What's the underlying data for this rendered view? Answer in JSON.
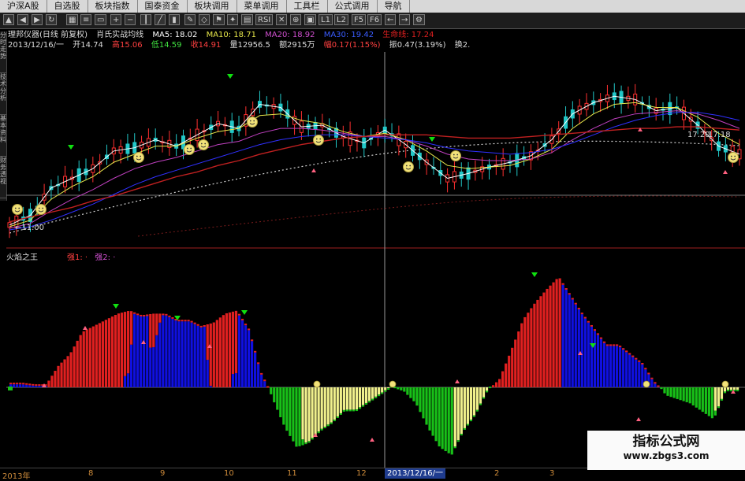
{
  "menu": [
    {
      "label": "沪深A股"
    },
    {
      "label": "自选股"
    },
    {
      "label": "板块指数"
    },
    {
      "label": "国泰资金"
    },
    {
      "label": "板块调用"
    },
    {
      "label": "菜单调用"
    },
    {
      "label": "工具栏"
    },
    {
      "label": "公式调用"
    },
    {
      "label": "导航"
    }
  ],
  "toolbar": [
    {
      "label": "RSI"
    },
    {
      "label": "L1"
    },
    {
      "label": "L2"
    },
    {
      "label": "F5"
    },
    {
      "label": "F6"
    }
  ],
  "side_tabs": [
    {
      "label": "分时走势"
    },
    {
      "label": "技术分析"
    },
    {
      "label": "基本资料"
    },
    {
      "label": "财务透视"
    }
  ],
  "stock": {
    "name": "理邦仪器(日线 前复权)",
    "indicator_name": "肖氏实战均线",
    "ma5": "MA5: 18.02",
    "ma10": "MA10: 18.71",
    "ma20": "MA20: 18.92",
    "ma30": "MA30: 19.42",
    "life_line": "生命线: 17.24",
    "date": "2013/12/16/一",
    "open": "开14.74",
    "high": "高15.06",
    "low": "低14.59",
    "close": "收14.91",
    "volume": "量12956.5",
    "amount": "额2915万",
    "change": "幅0.17(1.15%)",
    "amplitude": "振0.47(3.19%)",
    "turnover": "换2."
  },
  "price_labels": {
    "low": "←11.00",
    "right1": "17.20",
    "right2": "17.18"
  },
  "indicator": {
    "title": "火焰之王",
    "legend1": "强1: ·",
    "legend2": "强2: ·"
  },
  "bottom_axis": {
    "year": "2013年",
    "months": [
      "8",
      "9",
      "10",
      "11",
      "12",
      "2",
      "3"
    ],
    "cursor_date": "2013/12/16/一"
  },
  "watermark": {
    "title": "指标公式网",
    "url": "www.zbgs3.com"
  },
  "colors": {
    "up": "#ff3030",
    "down": "#22c8c8",
    "ma5": "#ffffff",
    "ma10": "#e6e64a",
    "ma20": "#c040c0",
    "ma30": "#3030ff",
    "life_line": "#c02020",
    "blue_fill": "#1010e0",
    "red_fill": "#e02020",
    "yellow_fill": "#f0f08c",
    "green_fill": "#18c018",
    "signal_arrow": "#10e010"
  },
  "chart_data": [
    {
      "type": "line",
      "title": "理邦仪器(日线 前复权)",
      "xlabel": "",
      "ylabel": "",
      "series": [
        {
          "name": "MA5",
          "values": [
            11.3,
            11.9,
            13.6,
            14.2,
            14.8,
            15.9,
            16.1,
            16.6,
            16.2,
            16.9,
            17.6,
            17.3,
            18.8,
            18.6,
            17.4,
            17.5,
            16.8,
            16.4,
            17.2,
            16.3,
            15.2,
            14.2,
            14.5,
            14.9,
            15.2,
            15.6,
            16.6,
            18.2,
            18.9,
            19.3,
            19.1,
            18.4,
            18.6,
            17.5,
            16.2,
            15.7
          ]
        },
        {
          "name": "MA10",
          "values": [
            11.2,
            11.6,
            12.9,
            13.7,
            14.3,
            15.2,
            15.7,
            16.2,
            16.2,
            16.7,
            17.1,
            17.3,
            18.1,
            18.2,
            17.8,
            17.6,
            17.1,
            16.8,
            17.0,
            16.6,
            15.9,
            15.0,
            14.8,
            14.9,
            15.0,
            15.4,
            16.0,
            17.3,
            18.2,
            18.8,
            18.9,
            18.6,
            18.6,
            18.0,
            17.0,
            16.3
          ]
        },
        {
          "name": "MA20",
          "values": [
            11.1,
            11.4,
            12.2,
            12.9,
            13.5,
            14.2,
            14.8,
            15.2,
            15.5,
            15.9,
            16.3,
            16.5,
            17.0,
            17.3,
            17.3,
            17.2,
            17.0,
            16.8,
            16.8,
            16.6,
            16.2,
            15.7,
            15.4,
            15.3,
            15.3,
            15.4,
            15.8,
            16.6,
            17.3,
            17.9,
            18.2,
            18.3,
            18.4,
            18.2,
            17.8,
            17.3
          ]
        },
        {
          "name": "MA30",
          "values": [
            11.0,
            11.2,
            11.6,
            12.1,
            12.6,
            13.2,
            13.8,
            14.3,
            14.7,
            15.1,
            15.5,
            15.9,
            16.3,
            16.6,
            16.8,
            16.9,
            16.9,
            16.8,
            16.7,
            16.6,
            16.4,
            16.1,
            15.9,
            15.8,
            15.7,
            15.8,
            16.0,
            16.4,
            16.9,
            17.4,
            17.8,
            18.1,
            18.3,
            18.3,
            18.1,
            17.8
          ]
        },
        {
          "name": "生命线",
          "values": [
            11.5,
            11.8,
            12.1,
            12.4,
            12.8,
            13.1,
            13.5,
            13.9,
            14.3,
            14.6,
            15.0,
            15.3,
            15.7,
            16.0,
            16.3,
            16.5,
            16.7,
            16.8,
            16.9,
            16.9,
            16.9,
            16.8,
            16.7,
            16.7,
            16.7,
            16.8,
            16.9,
            17.0,
            17.1,
            17.2,
            17.3,
            17.3,
            17.4,
            17.4,
            17.3,
            17.2
          ]
        }
      ],
      "price_range": [
        11.0,
        19.8
      ],
      "grid": false
    },
    {
      "type": "bar",
      "title": "火焰之王",
      "xlabel": "",
      "ylabel": "",
      "series": [
        {
          "name": "强1",
          "values": [
            3,
            3,
            2,
            2,
            14,
            22,
            36,
            40,
            44,
            48,
            50,
            47,
            48,
            48,
            44,
            44,
            40,
            42,
            48,
            50,
            38,
            10,
            -6,
            -20,
            -30,
            -28,
            -22,
            -18,
            -12,
            -12,
            -8,
            -4,
            0,
            -2,
            -8,
            -20,
            -30,
            -34,
            -22,
            -14,
            -2,
            5,
            24,
            44,
            55,
            64,
            72,
            60,
            48,
            38,
            28,
            28,
            22,
            16,
            4,
            -4,
            -6,
            -8,
            -12,
            -16,
            -2,
            -2
          ]
        }
      ],
      "ylim": [
        -45,
        80
      ],
      "grid": false
    }
  ]
}
